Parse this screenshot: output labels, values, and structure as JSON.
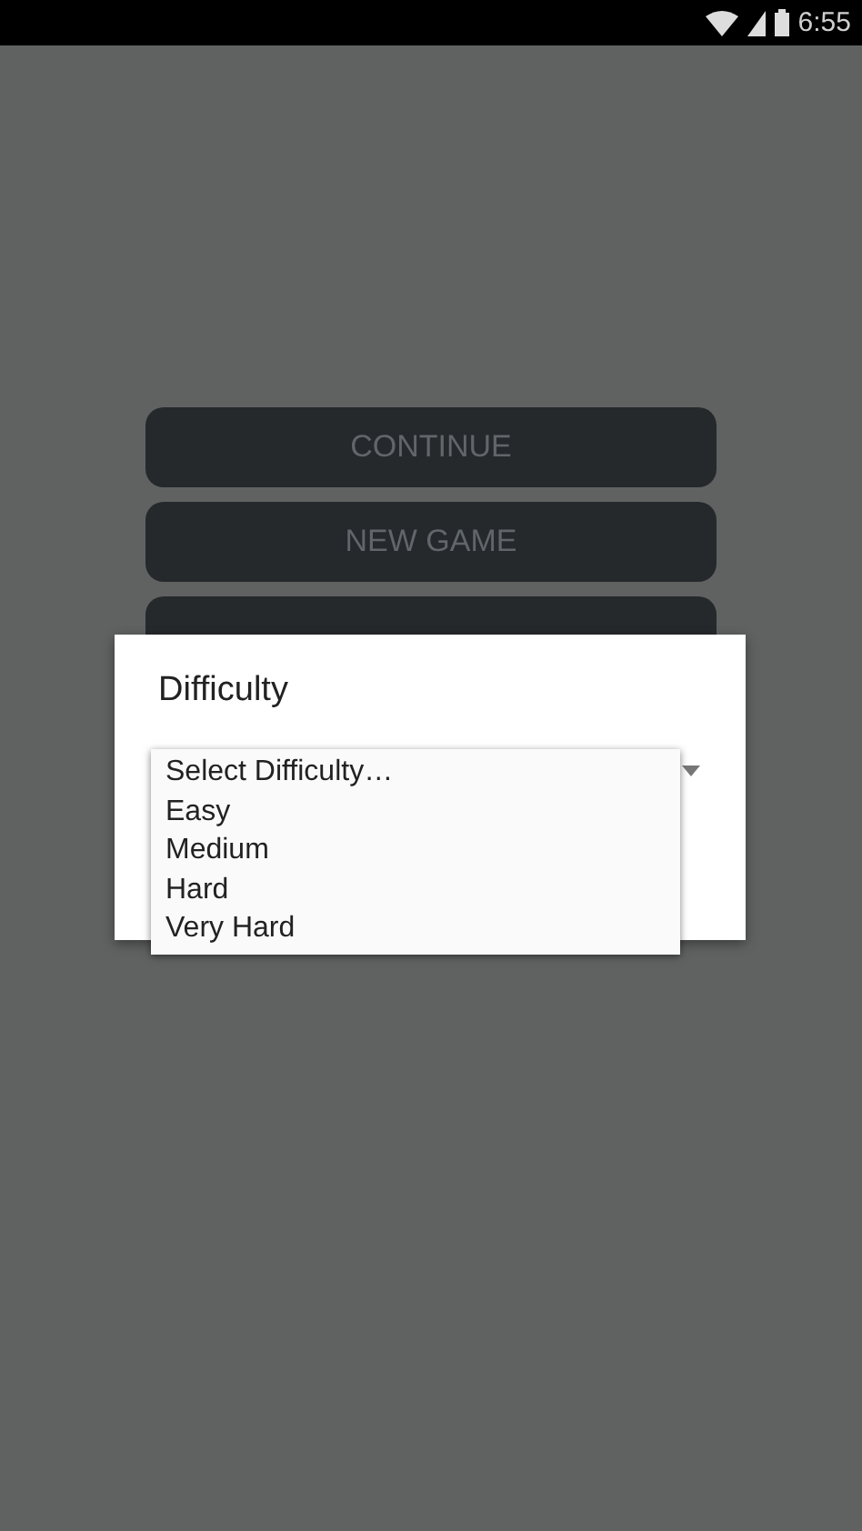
{
  "status_bar": {
    "time": "6:55"
  },
  "menu_buttons": [
    {
      "kind": "labeled",
      "label": "CONTINUE"
    },
    {
      "kind": "labeled",
      "label": "NEW GAME"
    },
    {
      "kind": "covered"
    }
  ],
  "dialog": {
    "title": "Difficulty",
    "dropdown": {
      "options": [
        "Select Difficulty…",
        "Easy",
        "Medium",
        "Hard",
        "Very Hard"
      ]
    }
  }
}
